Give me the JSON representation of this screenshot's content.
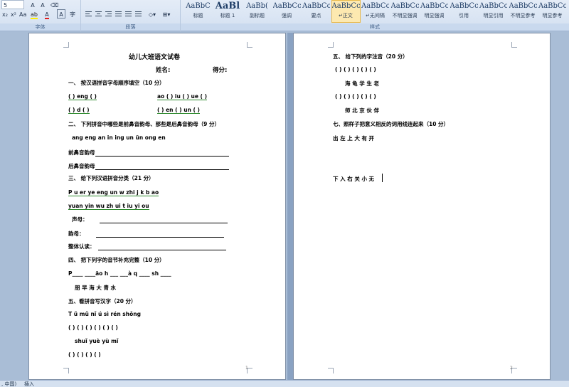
{
  "ribbon": {
    "font_group_label": "字体",
    "para_group_label": "段落",
    "styles_group_label": "样式",
    "styles": [
      {
        "preview": "AaBbC",
        "name": "标题",
        "big": false
      },
      {
        "preview": "AaBl",
        "name": "标题 1",
        "big": true
      },
      {
        "preview": "AaBb(",
        "name": "副标题",
        "big": false
      },
      {
        "preview": "AaBbCcDt",
        "name": "强调",
        "big": false
      },
      {
        "preview": "AaBbCcDt",
        "name": "要点",
        "big": false
      },
      {
        "preview": "AaBbCcDt",
        "name": "↵正文",
        "big": false,
        "active": true
      },
      {
        "preview": "AaBbCcDt",
        "name": "↵无间隔",
        "big": false
      },
      {
        "preview": "AaBbCcDt",
        "name": "不明显强调",
        "big": false
      },
      {
        "preview": "AaBbCcDt",
        "name": "明显强调",
        "big": false
      },
      {
        "preview": "AaBbCcDt",
        "name": "引用",
        "big": false
      },
      {
        "preview": "AaBbCcDt",
        "name": "明显引用",
        "big": false
      },
      {
        "preview": "AaBbCcDt",
        "name": "不明显参考",
        "big": false
      },
      {
        "preview": "AaBbCcDt",
        "name": "明显参考",
        "big": false
      }
    ]
  },
  "page1": {
    "title": "幼儿大班语文试卷",
    "name_label": "姓名:",
    "score_label": "得分:",
    "q1": "一、 按汉语拼音字母顺序填空（10 分）",
    "q1_row1_a": "(          ) eng  (      )",
    "q1_row1_b": "ao (    ) iu (     ) ue (      )",
    "q1_row2_a": "(    )  d    (          )",
    "q1_row2_b": "(      ) en   (       ) un  (      )",
    "q2": "二、 下列拼音中哪些是前鼻音韵母、那些是后鼻音韵母（9 分）",
    "q2_list": "ang     eng     an     in     ing     un     ün     ong     en",
    "q2_front": "前鼻音韵母",
    "q2_back": "后鼻音韵母",
    "q3": "三、 给下列汉语拼音分类（21 分）",
    "q3_row1": "P    u     er     ye     eng     un     w     zhi    j     k     b          ao",
    "q3_row2": "yuan      yin      wu      zh      ui      t      iu      yi     ou",
    "q3_initials": "声母：",
    "q3_finals": "韵母：",
    "q3_whole": "整体认读：",
    "q4": "四、 把下列字的音节补充完整（10 分）",
    "q4_row1": "P____      ____āo      h  ___      ___à      q  ____      sh  ____",
    "q4_row2": "朋          早            海            大            青            水",
    "q5": "五、看拼音写汉字（20 分）",
    "q5_row1": "T ǔ          mǔ          nǐ ú          sì          rén          shǒng",
    "q5_row2": "(     )     (     )     (     )     (     )     (     )     (     )",
    "q5_row3": "shuǐ          yuè          yù          mǐ",
    "q5_row4": "(     )      (     )      (     )      (     )",
    "page_number": "1"
  },
  "page2": {
    "q5": "五、 给下列的字注音（20 分）",
    "row1": "(          )     (          )     (          )     (          )     (          )",
    "row2": "海                龟                学                生                老",
    "row3": "(          )     (          )     (          )     (          )     (          )",
    "row4": "师                北                京                伙                伴",
    "q7": "七、照样子把意义相反的词用线连起来（10 分）",
    "row5": "出          左          上          大          有          开",
    "row6": "下          入          右          关          小          无",
    "page_number": "2"
  },
  "status": {
    "left": ", 中国)",
    "insert": "插入"
  }
}
